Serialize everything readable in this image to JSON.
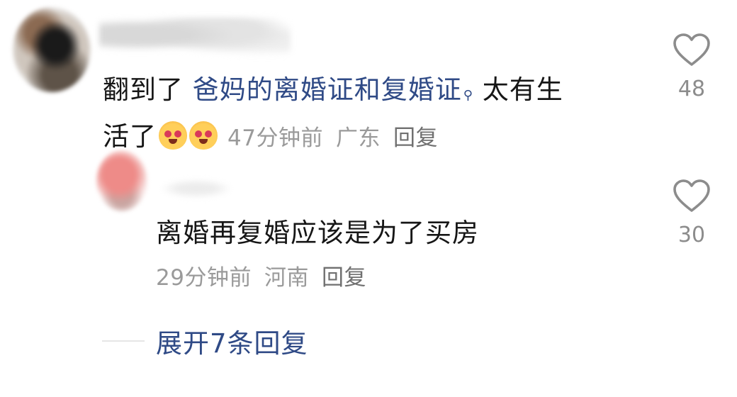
{
  "comments": [
    {
      "text_before": "翻到了 ",
      "keyword": "爸妈的离婚证和复婚证",
      "search_glyph": "⚲",
      "text_after_line1": " 太有生",
      "text_line2": "活了",
      "emojis": [
        "smile-emoji",
        "smile-emoji"
      ],
      "time": "47分钟前",
      "location": "广东",
      "reply_label": "回复",
      "likes": "48"
    },
    {
      "text": "离婚再复婚应该是为了买房",
      "time": "29分钟前",
      "location": "河南",
      "reply_label": "回复",
      "likes": "30"
    }
  ],
  "expand_replies": "展开7条回复",
  "colors": {
    "text": "#161616",
    "link": "#2f4a86",
    "meta": "#9a9a9a",
    "like_icon": "#8c8c8c"
  },
  "icons": {
    "like": "heart-outline-icon",
    "search": "search-icon"
  }
}
